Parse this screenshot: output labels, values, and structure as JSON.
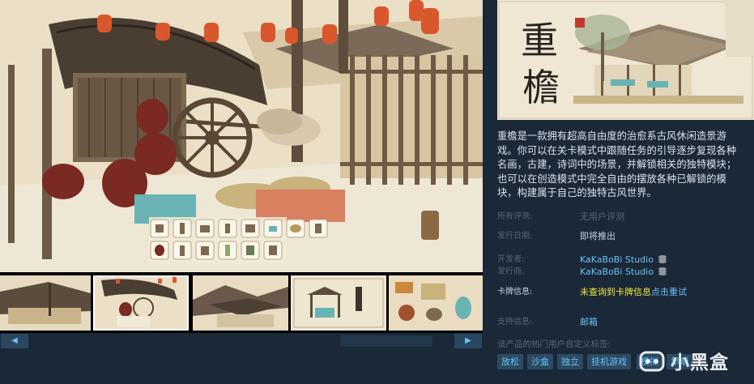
{
  "store": {
    "description": "重檐是一款拥有超高自由度的治愈系古风休闲造景游戏。你可以在关卡模式中跟随任务的引导逐步复现各种名画，古建，诗词中的场景，并解锁相关的独特模块；也可以在创造模式中完全自由的摆放各种已解锁的模块，构建属于自己的独特古风世界。",
    "review_label": "所有评测:",
    "review_value": "无用户评测",
    "release_label": "发行日期:",
    "release_value": "即将推出",
    "developer_label": "开发者:",
    "developer_value": "KaKaBoBi Studio",
    "publisher_label": "发行商:",
    "publisher_value": "KaKaBoBi Studio",
    "cards_label": "卡牌信息:",
    "cards_warning": "未查询到卡牌信息",
    "cards_retry": "点击重试",
    "support_label": "支持信息:",
    "support_value": "邮箱",
    "tags_title": "该产品的热门用户自定义标签:",
    "tags": [
      "放松",
      "沙盒",
      "独立",
      "挂机游戏",
      "模拟",
      "早期"
    ]
  },
  "header_logo": {
    "title_text": "重檐"
  },
  "watermark": {
    "text": "小黑盒"
  },
  "colors": {
    "page_bg": "#1b2838",
    "link": "#67c1f5",
    "warning": "#f0e442",
    "label": "#556772",
    "tag_bg": "#2c4a62"
  },
  "icons": {
    "scroll_left": "left-arrow-icon",
    "scroll_right": "right-arrow-icon",
    "developer_link": "stack-icon",
    "publisher_link": "stack-icon"
  },
  "media": {
    "thumb_count": 5,
    "active_thumb": 1
  }
}
